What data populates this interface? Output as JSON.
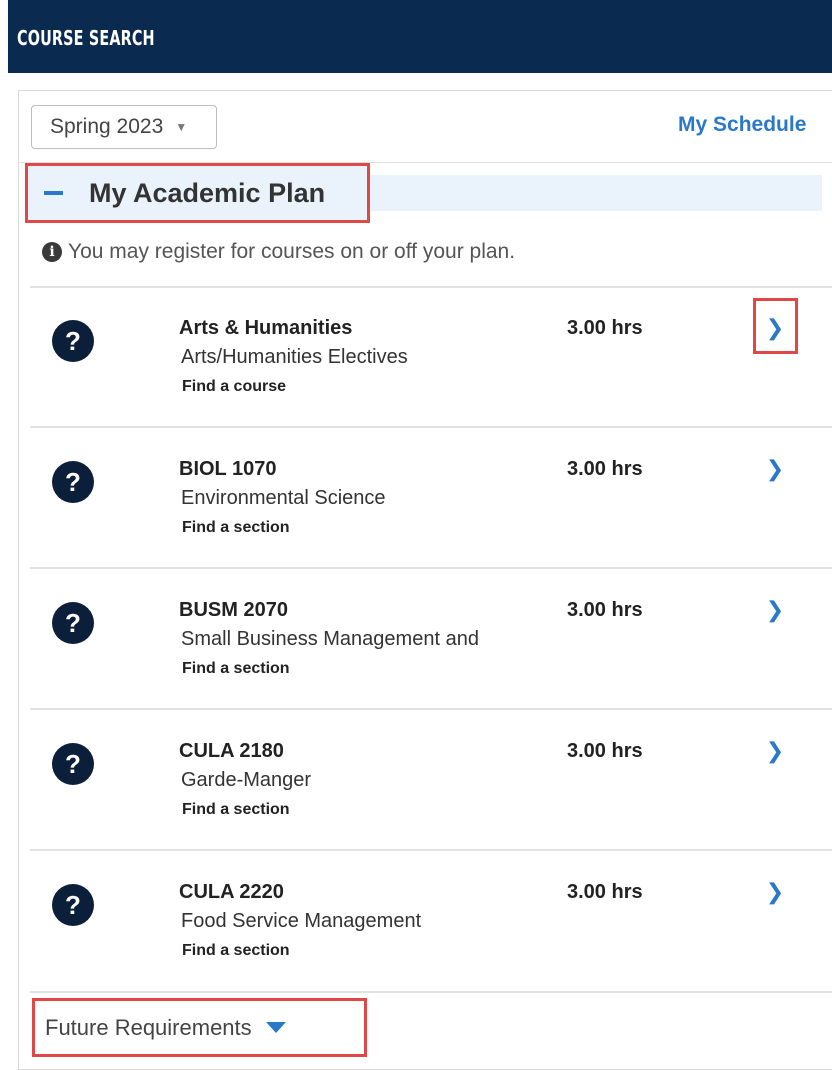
{
  "header": {
    "title": "COURSE SEARCH"
  },
  "toolbar": {
    "term_value": "Spring 2023",
    "my_schedule": "My Schedule"
  },
  "plan": {
    "title": "My Academic Plan",
    "info": "You may register for courses on or off your plan.",
    "courses": [
      {
        "title": "Arts & Humanities",
        "desc": "Arts/Humanities Electives",
        "link": "Find a course",
        "hours": "3.00 hrs"
      },
      {
        "title": "BIOL 1070",
        "desc": "Environmental Science",
        "link": "Find a section",
        "hours": "3.00 hrs"
      },
      {
        "title": "BUSM 2070",
        "desc": "Small Business Management and",
        "link": "Find a section",
        "hours": "3.00 hrs"
      },
      {
        "title": "CULA 2180",
        "desc": "Garde-Manger",
        "link": "Find a section",
        "hours": "3.00 hrs"
      },
      {
        "title": "CULA 2220",
        "desc": "Food Service Management",
        "link": "Find a section",
        "hours": "3.00 hrs"
      }
    ]
  },
  "future": {
    "label": "Future Requirements"
  },
  "colors": {
    "header_bg": "#0b2a4f",
    "accent": "#2a78c8",
    "highlight": "#e04848"
  }
}
